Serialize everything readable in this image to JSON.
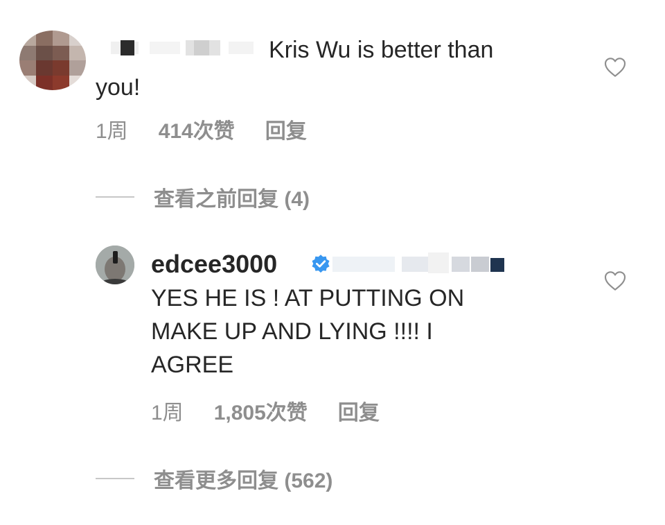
{
  "comment1": {
    "text_line1": "Kris Wu is better than",
    "text_line2": "you!",
    "time": "1周",
    "likes": "414次赞",
    "reply_label": "回复",
    "view_replies": "查看之前回复 (4)"
  },
  "comment2": {
    "username": "edcee3000",
    "text_line1": "YES HE IS ! AT PUTTING ON",
    "text_line2": "MAKE UP AND LYING !!!! I",
    "text_line3": "AGREE",
    "time": "1周",
    "likes": "1,805次赞",
    "reply_label": "回复",
    "view_replies": "查看更多回复 (562)"
  },
  "colors": {
    "text": "#262626",
    "meta": "#8e8e8e",
    "verified": "#3897f0"
  },
  "icons": {
    "like": "heart-outline-icon",
    "verified": "verified-badge-icon"
  }
}
